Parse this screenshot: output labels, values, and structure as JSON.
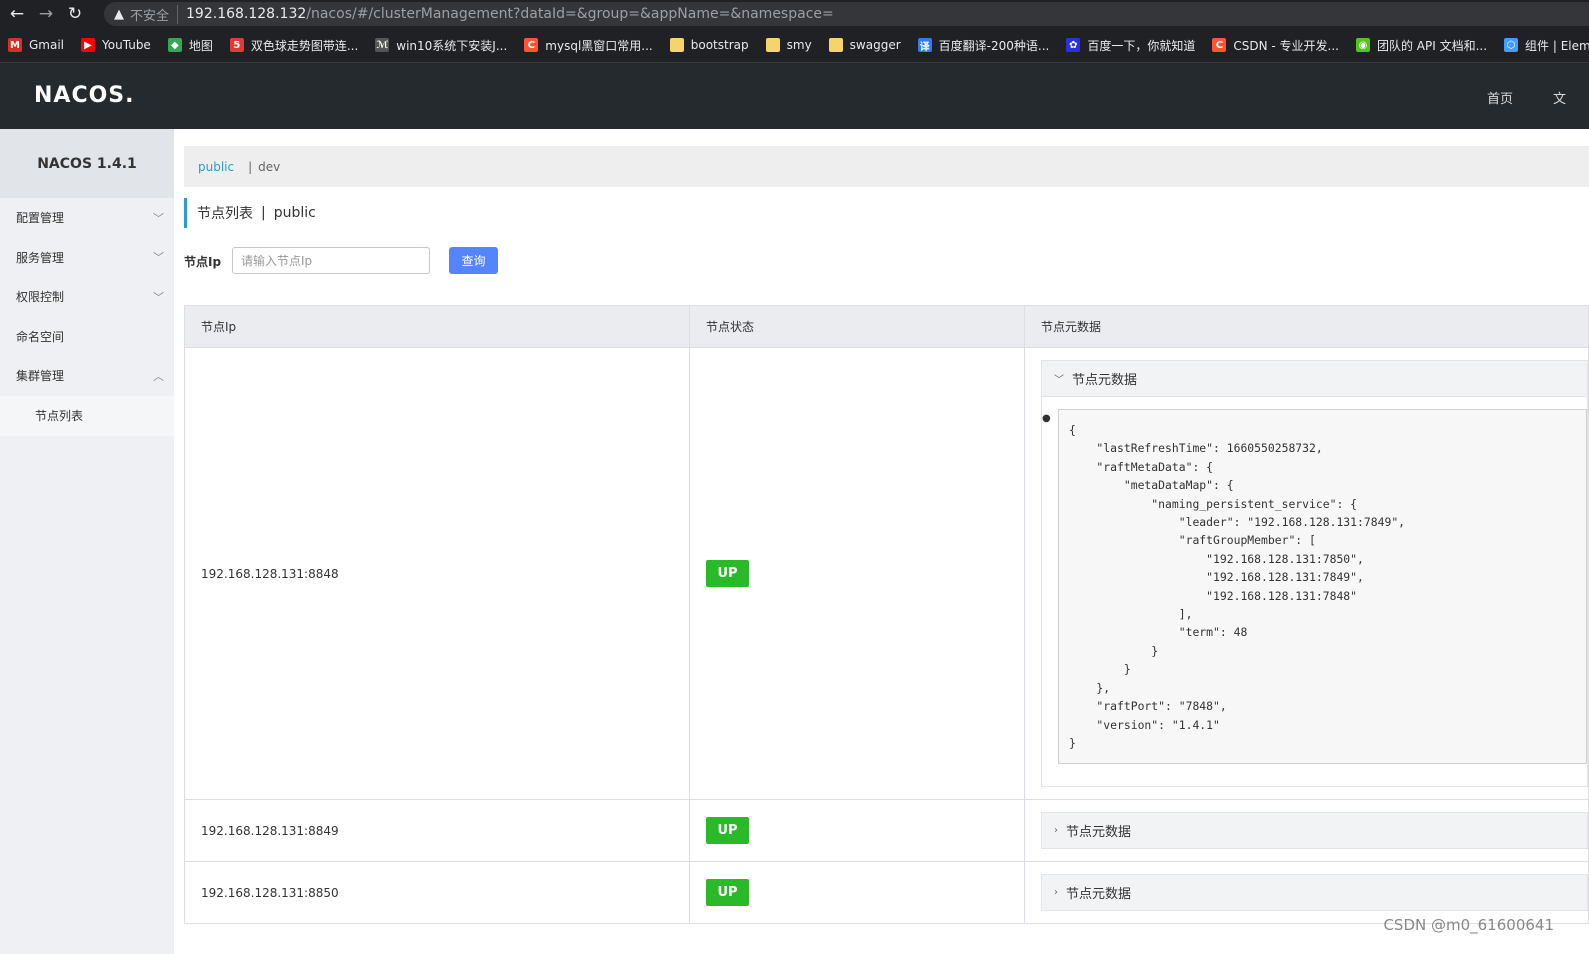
{
  "browser": {
    "insecure_label": "不安全",
    "url_host": "192.168.128.132",
    "url_path": "/nacos/#/clusterManagement?dataId=&group=&appName=&namespace=",
    "bookmarks": [
      {
        "label": "Gmail",
        "icon": "gmail-icon",
        "color": "#d93025",
        "glyph": "M"
      },
      {
        "label": "YouTube",
        "icon": "youtube-icon",
        "color": "#ff0000",
        "glyph": "▶"
      },
      {
        "label": "地图",
        "icon": "maps-icon",
        "color": "#34a853",
        "glyph": "◆"
      },
      {
        "label": "双色球走势图带连...",
        "icon": "lottery-icon",
        "color": "#e53935",
        "glyph": "5"
      },
      {
        "label": "win10系统下安装J...",
        "icon": "win10-icon",
        "color": "#555555",
        "glyph": "ℳ"
      },
      {
        "label": "mysql黑窗口常用...",
        "icon": "csdn-icon",
        "color": "#fc5531",
        "glyph": "C"
      },
      {
        "label": "bootstrap",
        "icon": "folder-icon",
        "color": "#f6d36b",
        "glyph": ""
      },
      {
        "label": "smy",
        "icon": "folder-icon",
        "color": "#f6d36b",
        "glyph": ""
      },
      {
        "label": "swagger",
        "icon": "folder-icon",
        "color": "#f6d36b",
        "glyph": ""
      },
      {
        "label": "百度翻译-200种语...",
        "icon": "baidu-translate-icon",
        "color": "#2b7cf6",
        "glyph": "译"
      },
      {
        "label": "百度一下，你就知道",
        "icon": "baidu-icon",
        "color": "#2932e1",
        "glyph": "✿"
      },
      {
        "label": "CSDN - 专业开发...",
        "icon": "csdn-icon",
        "color": "#fc5531",
        "glyph": "C"
      },
      {
        "label": "团队的 API 文档和...",
        "icon": "apifox-icon",
        "color": "#52c41a",
        "glyph": "◉"
      },
      {
        "label": "组件 | Element",
        "icon": "element-icon",
        "color": "#409eff",
        "glyph": "⬡"
      }
    ]
  },
  "header": {
    "logo": "NACOS.",
    "links": [
      "首页",
      "文"
    ]
  },
  "sidebar": {
    "title": "NACOS 1.4.1",
    "items": [
      {
        "label": "配置管理",
        "expanded": false
      },
      {
        "label": "服务管理",
        "expanded": false
      },
      {
        "label": "权限控制",
        "expanded": false
      },
      {
        "label": "命名空间",
        "expanded": null
      },
      {
        "label": "集群管理",
        "expanded": true
      }
    ],
    "sub_items": [
      "节点列表"
    ]
  },
  "namespace_bar": {
    "active": "public",
    "others": [
      "dev"
    ]
  },
  "page": {
    "title": "节点列表",
    "namespace": "public"
  },
  "search": {
    "label": "节点Ip",
    "placeholder": "请输入节点Ip",
    "value": "",
    "button": "查询"
  },
  "table": {
    "headers": [
      "节点Ip",
      "节点状态",
      "节点元数据"
    ],
    "metadata_label": "节点元数据",
    "rows": [
      {
        "ip": "192.168.128.131:8848",
        "status": "UP",
        "expanded": true,
        "metadata_json": "{\n    \"lastRefreshTime\": 1660550258732,\n    \"raftMetaData\": {\n        \"metaDataMap\": {\n            \"naming_persistent_service\": {\n                \"leader\": \"192.168.128.131:7849\",\n                \"raftGroupMember\": [\n                    \"192.168.128.131:7850\",\n                    \"192.168.128.131:7849\",\n                    \"192.168.128.131:7848\"\n                ],\n                \"term\": 48\n            }\n        }\n    },\n    \"raftPort\": \"7848\",\n    \"version\": \"1.4.1\"\n}"
      },
      {
        "ip": "192.168.128.131:8849",
        "status": "UP",
        "expanded": false
      },
      {
        "ip": "192.168.128.131:8850",
        "status": "UP",
        "expanded": false
      }
    ]
  },
  "watermark": "CSDN @m0_61600641",
  "colors": {
    "accent": "#2a9bd5",
    "button": "#5584ff",
    "status_up": "#2ab928",
    "header_bg": "#252a2f"
  }
}
